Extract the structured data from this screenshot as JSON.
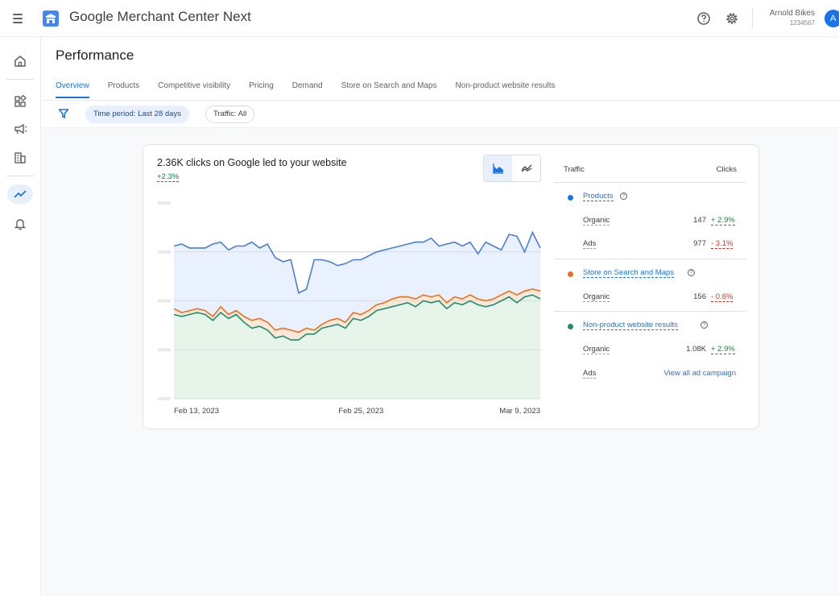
{
  "app": {
    "title": "Google Merchant Center Next",
    "account_name": "Arnold Bikes",
    "account_id": "1234567",
    "avatar_letter": "A"
  },
  "page": {
    "title": "Performance",
    "tabs": [
      {
        "label": "Overview",
        "active": true
      },
      {
        "label": "Products",
        "active": false
      },
      {
        "label": "Competitive visibility",
        "active": false
      },
      {
        "label": "Pricing",
        "active": false
      },
      {
        "label": "Demand",
        "active": false
      },
      {
        "label": "Store on Search and Maps",
        "active": false
      },
      {
        "label": "Non-product website results",
        "active": false
      }
    ]
  },
  "filters": {
    "time_period": "Time period: Last 28 days",
    "traffic": "Traffic: All"
  },
  "card": {
    "title": "2.36K clicks on Google led to your website",
    "delta": "+2.3%"
  },
  "chart_data": {
    "type": "area",
    "x_tick_labels": [
      "Feb 13, 2023",
      "Feb 25, 2023",
      "Mar 9, 2023"
    ],
    "series": [
      {
        "name": "Products",
        "color": "#4a7fd4",
        "values": [
          78,
          79,
          77,
          77,
          77,
          79,
          80,
          76,
          78,
          78,
          80,
          77,
          79,
          72,
          70,
          71,
          54,
          56,
          71,
          71,
          70,
          68,
          69,
          71,
          71,
          73,
          75,
          76,
          77,
          78,
          79,
          80,
          80,
          82,
          78,
          79,
          80,
          78,
          80,
          74,
          80,
          78,
          76,
          84,
          83,
          75,
          85,
          77
        ]
      },
      {
        "name": "Store on Search and Maps",
        "color": "#e8711f",
        "values": [
          46,
          44,
          45,
          46,
          45,
          42,
          47,
          43,
          45,
          42,
          40,
          41,
          39,
          35,
          36,
          35,
          34,
          36,
          35,
          38,
          40,
          41,
          39,
          44,
          43,
          45,
          48,
          49,
          51,
          52,
          52,
          51,
          53,
          52,
          53,
          49,
          52,
          51,
          53,
          51,
          50,
          51,
          53,
          55,
          53,
          55,
          56,
          55
        ]
      },
      {
        "name": "Non-product website results",
        "color": "#1e8e6e",
        "values": [
          43,
          42,
          43,
          44,
          43,
          40,
          44,
          41,
          43,
          39,
          36,
          37,
          35,
          31,
          32,
          30,
          30,
          33,
          33,
          36,
          37,
          38,
          36,
          41,
          40,
          42,
          45,
          46,
          47,
          48,
          49,
          47,
          50,
          49,
          50,
          46,
          49,
          48,
          50,
          48,
          47,
          48,
          50,
          52,
          49,
          52,
          53,
          51
        ]
      }
    ],
    "legend_position": "right",
    "grid": true
  },
  "legend": {
    "header_left": "Traffic",
    "header_right": "Clicks",
    "products": {
      "label": "Products",
      "organic_label": "Organic",
      "organic_value": "147",
      "organic_delta": "+ 2.9%",
      "ads_label": "Ads",
      "ads_value": "977",
      "ads_delta": "- 3.1%"
    },
    "store": {
      "label": "Store on Search and Maps",
      "organic_label": "Organic",
      "organic_value": "156",
      "organic_delta": "- 0.6%"
    },
    "nonproduct": {
      "label": "Non-product website results",
      "organic_label": "Organic",
      "organic_value": "1.08K",
      "organic_delta": "+ 2.9%",
      "ads_label": "Ads",
      "campaign_link": "View all ad campaign"
    }
  },
  "icons": {
    "menu": "menu-icon",
    "logo": "merchant-center-logo",
    "help": "help-icon",
    "settings": "gear-icon",
    "home": "home-icon",
    "products": "grid-icon",
    "marketing": "megaphone-icon",
    "business": "store-icon",
    "performance": "trending-icon",
    "notifications": "bell-icon",
    "filter": "filter-icon",
    "area_chart": "area-chart-icon",
    "line_chart": "line-chart-icon"
  },
  "colors": {
    "accent": "#1a73e8",
    "positive": "#188038",
    "negative": "#d93025",
    "products": "#1a73e8",
    "store": "#e8711f",
    "nonproduct": "#1e8e6e"
  }
}
